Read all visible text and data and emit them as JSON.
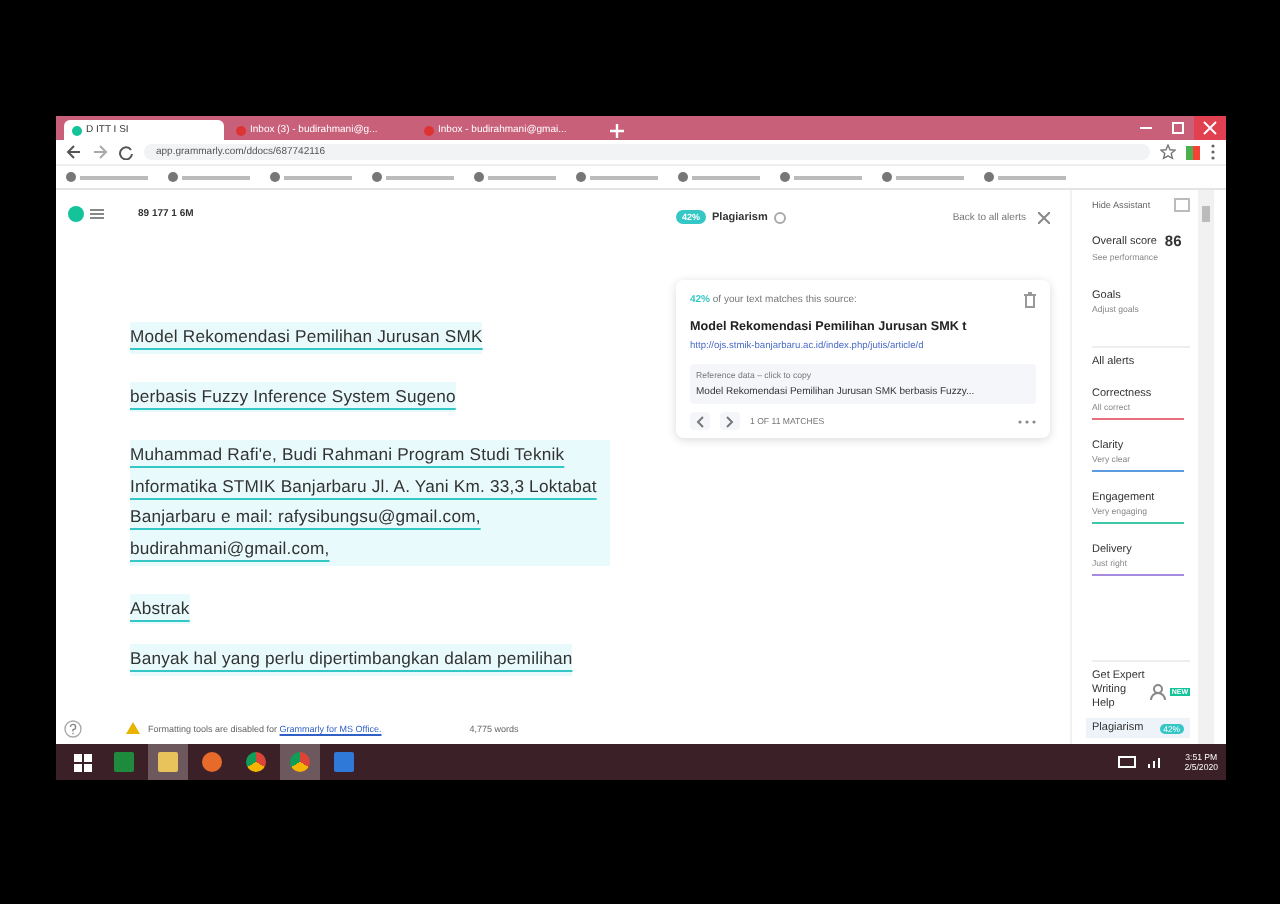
{
  "browser": {
    "tabs": [
      {
        "title": "D ITT I SI",
        "selected": true
      },
      {
        "title": "Inbox (3) - budirahmani@g...",
        "selected": false
      },
      {
        "title": "Inbox - budirahmani@gmai...",
        "selected": false
      }
    ],
    "address": "app.grammarly.com/ddocs/687742116"
  },
  "document": {
    "header": "89 177 1 6M",
    "paragraphs": [
      {
        "text": "Model Rekomendasi Pemilihan  Jurusan SMK",
        "highlighted": true
      },
      {
        "text": "berbasis Fuzzy Inference System Sugeno",
        "highlighted": true
      },
      {
        "text": "Muhammad Rafi'e, Budi Rahmani Program Studi Teknik Informatika STMIK Banjarbaru Jl. A. Yani Km. 33,3 Loktabat Banjarbaru e mail: rafysibungsu@gmail.com, budirahmani@gmail.com,",
        "highlighted": true
      },
      {
        "text": "Abstrak",
        "highlighted": true
      },
      {
        "text": "Banyak hal yang perlu dipertimbangkan dalam pemilihan",
        "highlighted": true
      }
    ],
    "notice": "Formatting tools are disabled for ",
    "notice_link": "Grammarly for MS Office.",
    "word_count": "4,775 words"
  },
  "plagiarism": {
    "badge": "42%",
    "title": "Plagiarism",
    "back": "Back to all alerts",
    "card": {
      "percent": "42%",
      "match_text": " of your text matches this source:",
      "source_title": "Model Rekomendasi Pemilihan Jurusan SMK t",
      "url": "http://ojs.stmik-banjarbaru.ac.id/index.php/jutis/article/d",
      "reference_label": "Reference data – click to copy",
      "reference_text": "Model Rekomendasi Pemilihan Jurusan SMK berbasis Fuzzy...",
      "pager": "1 OF 11 MATCHES"
    }
  },
  "sidebar": {
    "hide": "Hide Assistant",
    "score_label": "Overall score",
    "score": "86",
    "score_link": "See performance",
    "goals": "Goals",
    "goals_sub": "Adjust goals",
    "all_alerts": "All alerts",
    "categories": [
      {
        "name": "Correctness",
        "status": "All correct",
        "color": "#e8707e"
      },
      {
        "name": "Clarity",
        "status": "Very clear",
        "color": "#5b9be0"
      },
      {
        "name": "Engagement",
        "status": "Very engaging",
        "color": "#3cc7a8"
      },
      {
        "name": "Delivery",
        "status": "Just right",
        "color": "#a78be0"
      }
    ],
    "expert": "Get Expert Writing Help",
    "expert_badge": "NEW",
    "plagiarism": "Plagiarism",
    "plagiarism_badge": "42%"
  },
  "taskbar": {
    "time": "3:51 PM",
    "date": "2/5/2020"
  }
}
